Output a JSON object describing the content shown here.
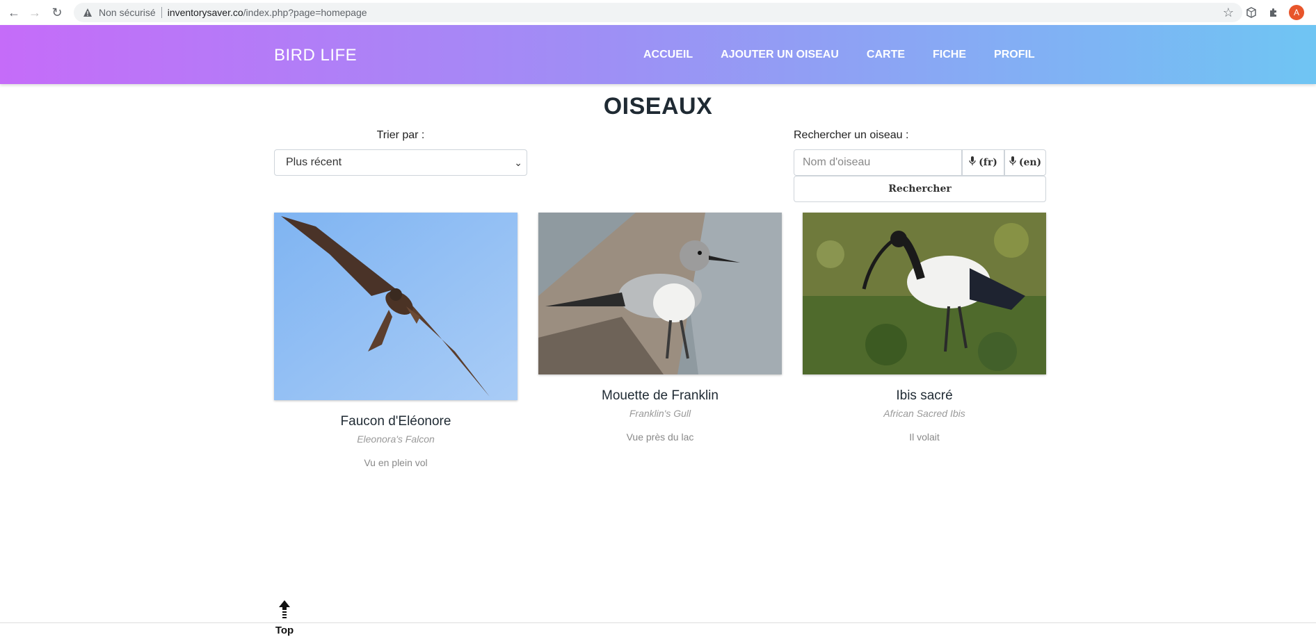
{
  "browser": {
    "security_label": "Non sécurisé",
    "url_host": "inventorysaver.co",
    "url_path": "/index.php?page=homepage",
    "profile_initial": "A"
  },
  "site": {
    "brand": "BIRD LIFE",
    "menu": [
      "ACCUEIL",
      "AJOUTER UN OISEAU",
      "CARTE",
      "FICHE",
      "PROFIL"
    ]
  },
  "page": {
    "title": "OISEAUX",
    "sort_label": "Trier par :",
    "sort_selected": "Plus récent",
    "search_label": "Rechercher un oiseau :",
    "search_placeholder": "Nom d'oiseau",
    "mic_fr": "(fr)",
    "mic_en": "(en)",
    "search_button": "Rechercher"
  },
  "birds": [
    {
      "name": "Faucon d'Eléonore",
      "latin": "Eleonora's Falcon",
      "note": "Vu en plein vol"
    },
    {
      "name": "Mouette de Franklin",
      "latin": "Franklin's Gull",
      "note": "Vue près du lac"
    },
    {
      "name": "Ibis sacré",
      "latin": "African Sacred Ibis",
      "note": "Il volait"
    }
  ],
  "footer": {
    "top_label": "Top"
  }
}
